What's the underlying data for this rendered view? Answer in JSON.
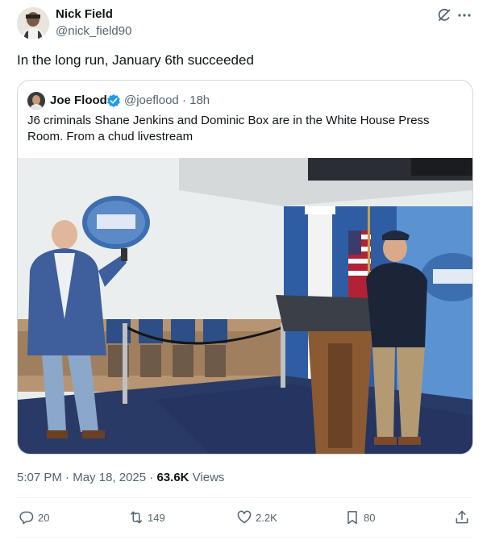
{
  "tweet": {
    "author_name": "Nick Field",
    "author_handle": "@nick_field90",
    "text": "In the long run, January 6th succeeded",
    "time": "5:07 PM",
    "date": "May 18, 2025",
    "views_count": "63.6K",
    "views_label": "Views"
  },
  "quote": {
    "author_name": "Joe Flood",
    "author_handle": "@joeflood",
    "age": "18h",
    "text": "J6 criminals Shane Jenkins and Dominic Box are in the White House Press Room. From a chud livestream"
  },
  "actions": {
    "replies": "20",
    "retweets": "149",
    "likes": "2.2K",
    "bookmarks": "80"
  },
  "icons": {
    "grok": "grok-icon",
    "more": "more-icon",
    "verified": "verified-badge-icon",
    "reply": "reply-icon",
    "retweet": "retweet-icon",
    "like": "heart-icon",
    "bookmark": "bookmark-icon",
    "share": "share-icon"
  },
  "colors": {
    "text": "#0f1419",
    "secondary": "#536471",
    "border": "#cfd9de",
    "verified": "#1d9bf0"
  }
}
